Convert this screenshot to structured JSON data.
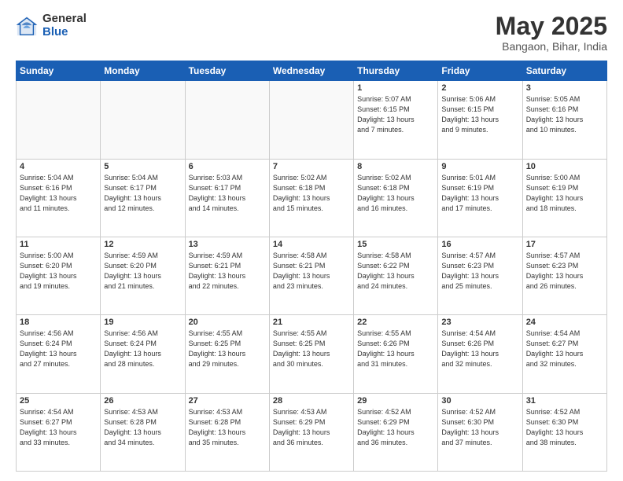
{
  "logo": {
    "general": "General",
    "blue": "Blue"
  },
  "header": {
    "month": "May 2025",
    "location": "Bangaon, Bihar, India"
  },
  "weekdays": [
    "Sunday",
    "Monday",
    "Tuesday",
    "Wednesday",
    "Thursday",
    "Friday",
    "Saturday"
  ],
  "weeks": [
    [
      {
        "day": "",
        "info": ""
      },
      {
        "day": "",
        "info": ""
      },
      {
        "day": "",
        "info": ""
      },
      {
        "day": "",
        "info": ""
      },
      {
        "day": "1",
        "info": "Sunrise: 5:07 AM\nSunset: 6:15 PM\nDaylight: 13 hours\nand 7 minutes."
      },
      {
        "day": "2",
        "info": "Sunrise: 5:06 AM\nSunset: 6:15 PM\nDaylight: 13 hours\nand 9 minutes."
      },
      {
        "day": "3",
        "info": "Sunrise: 5:05 AM\nSunset: 6:16 PM\nDaylight: 13 hours\nand 10 minutes."
      }
    ],
    [
      {
        "day": "4",
        "info": "Sunrise: 5:04 AM\nSunset: 6:16 PM\nDaylight: 13 hours\nand 11 minutes."
      },
      {
        "day": "5",
        "info": "Sunrise: 5:04 AM\nSunset: 6:17 PM\nDaylight: 13 hours\nand 12 minutes."
      },
      {
        "day": "6",
        "info": "Sunrise: 5:03 AM\nSunset: 6:17 PM\nDaylight: 13 hours\nand 14 minutes."
      },
      {
        "day": "7",
        "info": "Sunrise: 5:02 AM\nSunset: 6:18 PM\nDaylight: 13 hours\nand 15 minutes."
      },
      {
        "day": "8",
        "info": "Sunrise: 5:02 AM\nSunset: 6:18 PM\nDaylight: 13 hours\nand 16 minutes."
      },
      {
        "day": "9",
        "info": "Sunrise: 5:01 AM\nSunset: 6:19 PM\nDaylight: 13 hours\nand 17 minutes."
      },
      {
        "day": "10",
        "info": "Sunrise: 5:00 AM\nSunset: 6:19 PM\nDaylight: 13 hours\nand 18 minutes."
      }
    ],
    [
      {
        "day": "11",
        "info": "Sunrise: 5:00 AM\nSunset: 6:20 PM\nDaylight: 13 hours\nand 19 minutes."
      },
      {
        "day": "12",
        "info": "Sunrise: 4:59 AM\nSunset: 6:20 PM\nDaylight: 13 hours\nand 21 minutes."
      },
      {
        "day": "13",
        "info": "Sunrise: 4:59 AM\nSunset: 6:21 PM\nDaylight: 13 hours\nand 22 minutes."
      },
      {
        "day": "14",
        "info": "Sunrise: 4:58 AM\nSunset: 6:21 PM\nDaylight: 13 hours\nand 23 minutes."
      },
      {
        "day": "15",
        "info": "Sunrise: 4:58 AM\nSunset: 6:22 PM\nDaylight: 13 hours\nand 24 minutes."
      },
      {
        "day": "16",
        "info": "Sunrise: 4:57 AM\nSunset: 6:23 PM\nDaylight: 13 hours\nand 25 minutes."
      },
      {
        "day": "17",
        "info": "Sunrise: 4:57 AM\nSunset: 6:23 PM\nDaylight: 13 hours\nand 26 minutes."
      }
    ],
    [
      {
        "day": "18",
        "info": "Sunrise: 4:56 AM\nSunset: 6:24 PM\nDaylight: 13 hours\nand 27 minutes."
      },
      {
        "day": "19",
        "info": "Sunrise: 4:56 AM\nSunset: 6:24 PM\nDaylight: 13 hours\nand 28 minutes."
      },
      {
        "day": "20",
        "info": "Sunrise: 4:55 AM\nSunset: 6:25 PM\nDaylight: 13 hours\nand 29 minutes."
      },
      {
        "day": "21",
        "info": "Sunrise: 4:55 AM\nSunset: 6:25 PM\nDaylight: 13 hours\nand 30 minutes."
      },
      {
        "day": "22",
        "info": "Sunrise: 4:55 AM\nSunset: 6:26 PM\nDaylight: 13 hours\nand 31 minutes."
      },
      {
        "day": "23",
        "info": "Sunrise: 4:54 AM\nSunset: 6:26 PM\nDaylight: 13 hours\nand 32 minutes."
      },
      {
        "day": "24",
        "info": "Sunrise: 4:54 AM\nSunset: 6:27 PM\nDaylight: 13 hours\nand 32 minutes."
      }
    ],
    [
      {
        "day": "25",
        "info": "Sunrise: 4:54 AM\nSunset: 6:27 PM\nDaylight: 13 hours\nand 33 minutes."
      },
      {
        "day": "26",
        "info": "Sunrise: 4:53 AM\nSunset: 6:28 PM\nDaylight: 13 hours\nand 34 minutes."
      },
      {
        "day": "27",
        "info": "Sunrise: 4:53 AM\nSunset: 6:28 PM\nDaylight: 13 hours\nand 35 minutes."
      },
      {
        "day": "28",
        "info": "Sunrise: 4:53 AM\nSunset: 6:29 PM\nDaylight: 13 hours\nand 36 minutes."
      },
      {
        "day": "29",
        "info": "Sunrise: 4:52 AM\nSunset: 6:29 PM\nDaylight: 13 hours\nand 36 minutes."
      },
      {
        "day": "30",
        "info": "Sunrise: 4:52 AM\nSunset: 6:30 PM\nDaylight: 13 hours\nand 37 minutes."
      },
      {
        "day": "31",
        "info": "Sunrise: 4:52 AM\nSunset: 6:30 PM\nDaylight: 13 hours\nand 38 minutes."
      }
    ]
  ]
}
